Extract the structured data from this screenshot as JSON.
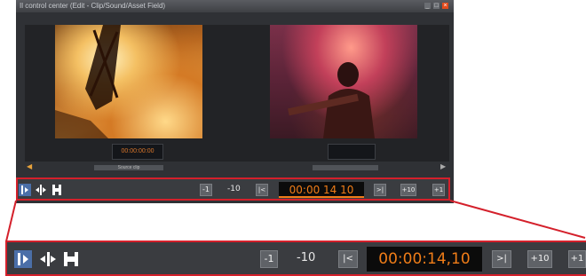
{
  "window": {
    "title": "Il control center (Edit - Clip/Sound/Asset Field)",
    "buttons": [
      "_",
      "□",
      "×"
    ],
    "colors": {
      "close": "#e24b1c",
      "accent": "#d4202b",
      "timecode": "#f07d18"
    }
  },
  "preview": {
    "left_timecode": "00:00:00:00",
    "left_strip_label": "Source clip",
    "right_timecode": ""
  },
  "toolbar": {
    "tools": [
      {
        "id": "trim-in",
        "icon": "trim-in-icon"
      },
      {
        "id": "ripple",
        "icon": "ripple-trim-icon"
      },
      {
        "id": "roll",
        "icon": "roll-trim-icon"
      }
    ],
    "minus1": "-1",
    "minus10": "-10",
    "jump_back_glyph": "|<",
    "timecode_small": "00:00 14 10",
    "timecode_big": "00:00:14,10",
    "jump_fwd_glyph": ">|",
    "plus10": "+10",
    "plus1": "+1"
  }
}
